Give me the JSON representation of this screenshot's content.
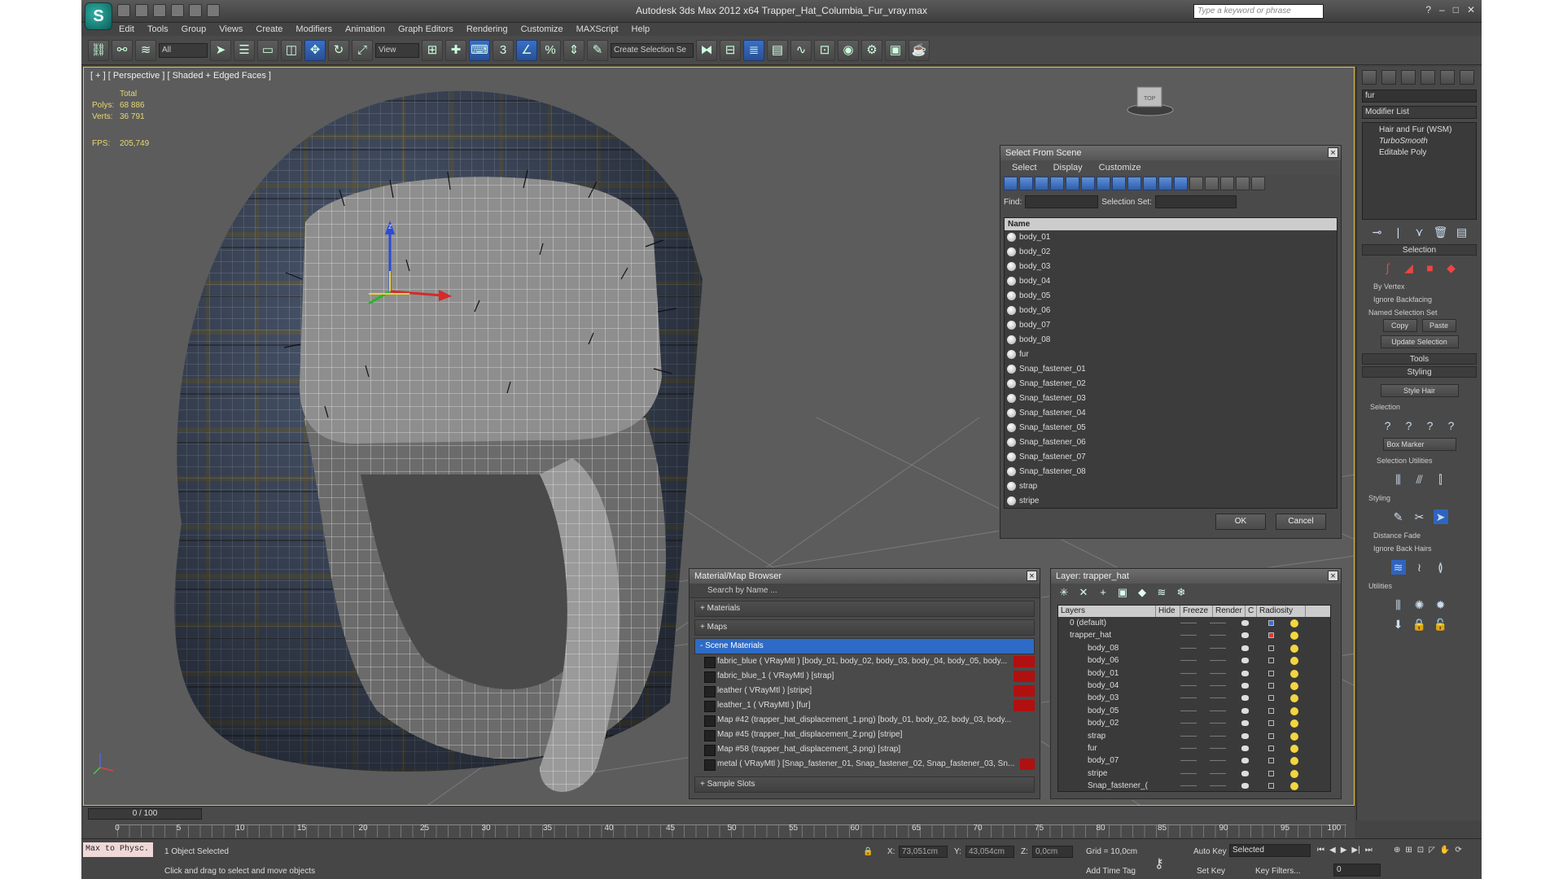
{
  "app": {
    "title": "Autodesk 3ds Max  2012 x64     Trapper_Hat_Columbia_Fur_vray.max",
    "search_placeholder": "Type a keyword or phrase"
  },
  "menu": [
    "Edit",
    "Tools",
    "Group",
    "Views",
    "Create",
    "Modifiers",
    "Animation",
    "Graph Editors",
    "Rendering",
    "Customize",
    "MAXScript",
    "Help"
  ],
  "toolbar": {
    "filter": "All",
    "ref_coord": "View",
    "selection_set": "Create Selection Se"
  },
  "viewport": {
    "label": "[ + ] [ Perspective ] [ Shaded + Edged Faces ]",
    "stats_header": "Total",
    "polys_label": "Polys:",
    "polys_value": "68 886",
    "verts_label": "Verts:",
    "verts_value": "36 791",
    "fps_label": "FPS:",
    "fps_value": "205,749"
  },
  "select_from_scene": {
    "title": "Select From Scene",
    "menu": [
      "Select",
      "Display",
      "Customize"
    ],
    "find_label": "Find:",
    "selection_set_label": "Selection Set:",
    "column_name": "Name",
    "items": [
      "body_01",
      "body_02",
      "body_03",
      "body_04",
      "body_05",
      "body_06",
      "body_07",
      "body_08",
      "fur",
      "Snap_fastener_01",
      "Snap_fastener_02",
      "Snap_fastener_03",
      "Snap_fastener_04",
      "Snap_fastener_05",
      "Snap_fastener_06",
      "Snap_fastener_07",
      "Snap_fastener_08",
      "strap",
      "stripe"
    ],
    "ok": "OK",
    "cancel": "Cancel"
  },
  "material_browser": {
    "title": "Material/Map Browser",
    "search_placeholder": "Search by Name ...",
    "sections": {
      "materials": "+ Materials",
      "maps": "+ Maps",
      "scene_materials": "- Scene Materials",
      "sample_slots": "+ Sample Slots"
    },
    "rows": [
      "fabric_blue  ( VRayMtl ) [body_01, body_02, body_03, body_04, body_05, body...",
      "fabric_blue_1  ( VRayMtl ) [strap]",
      "leather  ( VRayMtl ) [stripe]",
      "leather_1  ( VRayMtl ) [fur]",
      "Map #42 (trapper_hat_displacement_1.png) [body_01, body_02, body_03, body...",
      "Map #45 (trapper_hat_displacement_2.png) [stripe]",
      "Map #58 (trapper_hat_displacement_3.png) [strap]",
      "metal  ( VRayMtl ) [Snap_fastener_01, Snap_fastener_02, Snap_fastener_03, Sn..."
    ]
  },
  "layer_panel": {
    "title": "Layer: trapper_hat",
    "columns": [
      "Layers",
      "Hide",
      "Freeze",
      "Render",
      "C",
      "Radiosity"
    ],
    "rows": [
      {
        "name": "0 (default)",
        "level": "top"
      },
      {
        "name": "trapper_hat",
        "level": "top"
      },
      {
        "name": "body_08",
        "level": "child"
      },
      {
        "name": "body_06",
        "level": "child"
      },
      {
        "name": "body_01",
        "level": "child"
      },
      {
        "name": "body_04",
        "level": "child"
      },
      {
        "name": "body_03",
        "level": "child"
      },
      {
        "name": "body_05",
        "level": "child"
      },
      {
        "name": "body_02",
        "level": "child"
      },
      {
        "name": "strap",
        "level": "child"
      },
      {
        "name": "fur",
        "level": "child"
      },
      {
        "name": "body_07",
        "level": "child"
      },
      {
        "name": "stripe",
        "level": "child"
      },
      {
        "name": "Snap_fastener_(",
        "level": "child"
      }
    ]
  },
  "command_panel": {
    "object_name": "fur",
    "modifier_list": "Modifier List",
    "stack": [
      "Hair and Fur (WSM)",
      "TurboSmooth",
      "Editable Poly"
    ],
    "selection_rollout": "Selection",
    "by_vertex": "By Vertex",
    "ignore_backfacing": "Ignore Backfacing",
    "named_selection_set": "Named Selection Set",
    "copy": "Copy",
    "paste": "Paste",
    "update_selection": "Update Selection",
    "tools_rollout": "Tools",
    "styling_rollout": "Styling",
    "style_hair": "Style Hair",
    "selection_group": "Selection",
    "box_marker": "Box Marker",
    "selection_utilities": "Selection Utilities",
    "styling_group": "Styling",
    "distance_fade": "Distance Fade",
    "ignore_back_hairs": "Ignore Back Hairs",
    "utilities": "Utilities"
  },
  "timeline": {
    "slider": "0 / 100",
    "ticks": [
      "0",
      "5",
      "10",
      "15",
      "20",
      "25",
      "30",
      "35",
      "40",
      "45",
      "50",
      "55",
      "60",
      "65",
      "70",
      "75",
      "80",
      "85",
      "90",
      "95",
      "100"
    ]
  },
  "status": {
    "maxscript": "Max to Physc.",
    "selected": "1 Object Selected",
    "prompt": "Click and drag to select and move objects",
    "x_label": "X:",
    "x_value": "73,051cm",
    "y_label": "Y:",
    "y_value": "43,054cm",
    "z_label": "Z:",
    "z_value": "0,0cm",
    "grid": "Grid = 10,0cm",
    "add_time_tag": "Add Time Tag",
    "auto_key": "Auto Key",
    "set_key": "Set Key",
    "key_mode": "Selected",
    "key_filters": "Key Filters...",
    "frame": "0"
  }
}
